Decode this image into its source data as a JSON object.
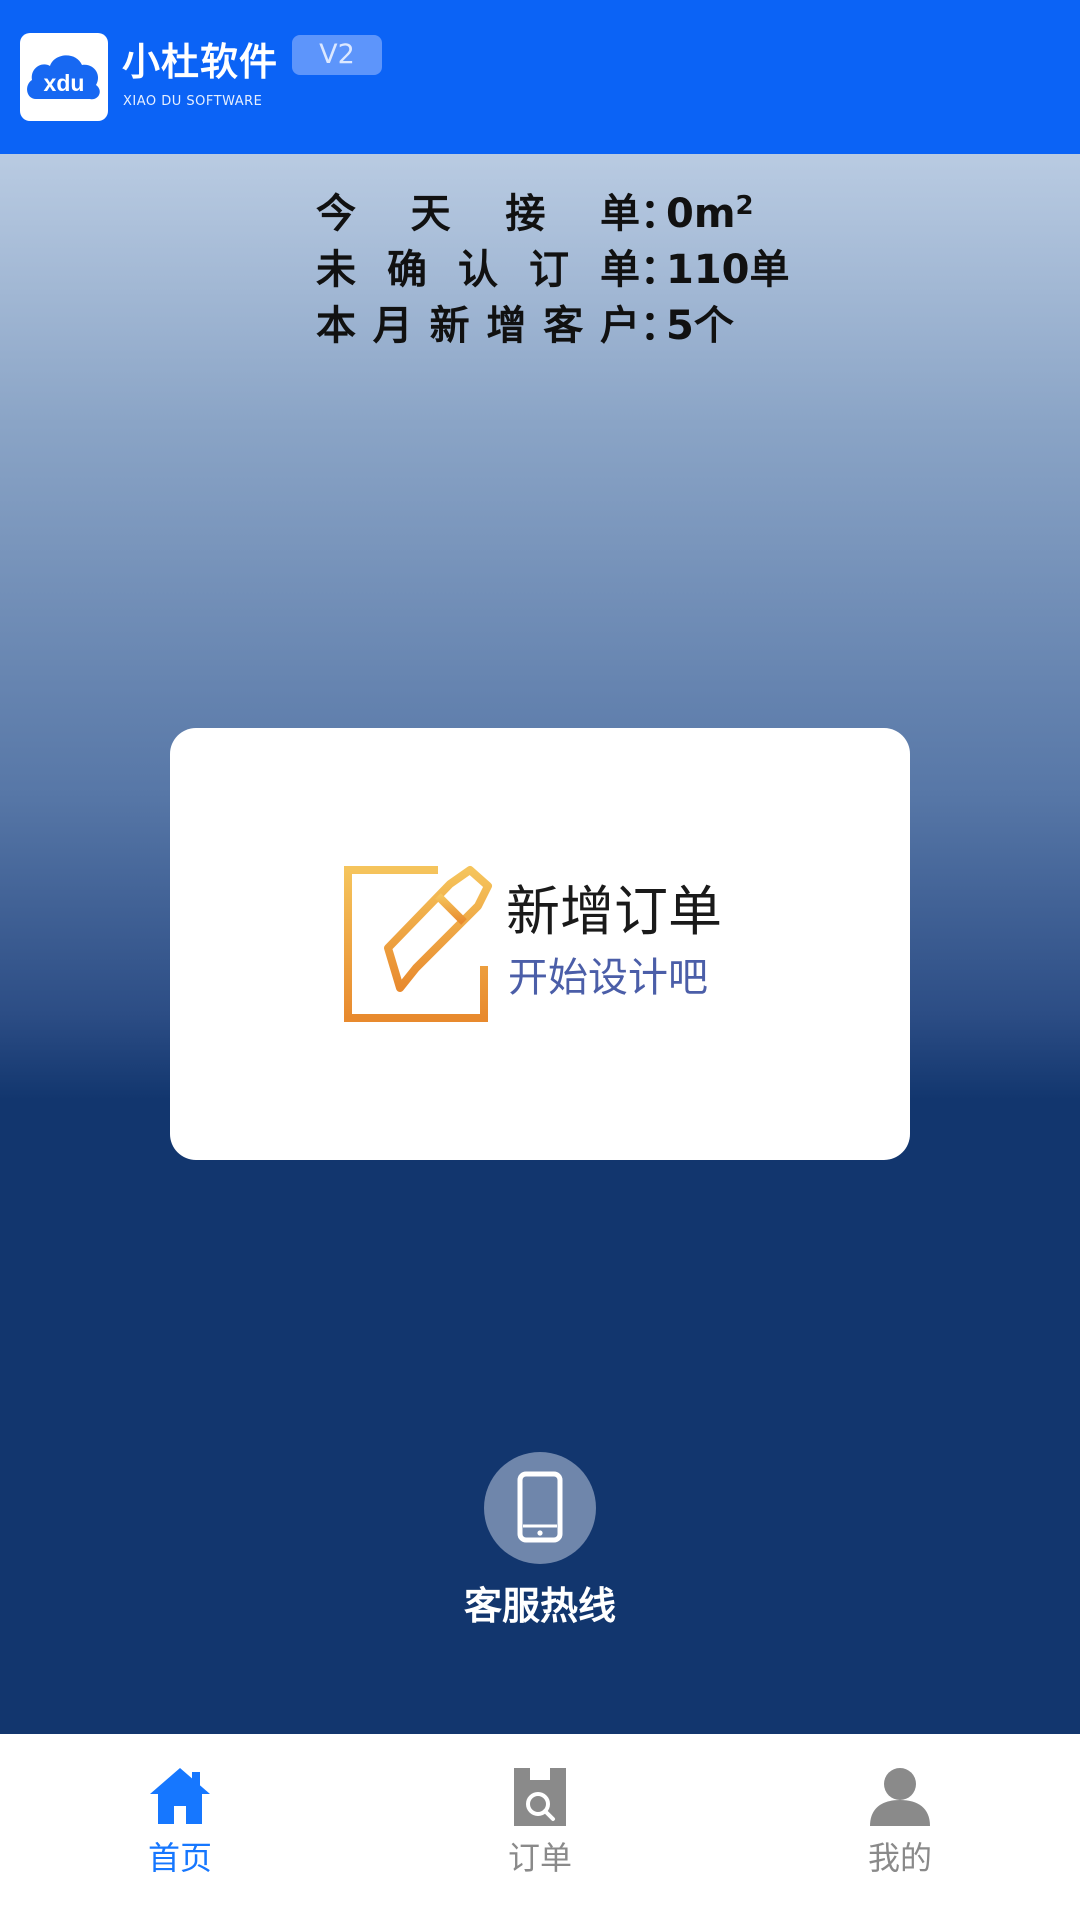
{
  "header": {
    "logo_text": "xdu",
    "brand_name": "小杜软件",
    "brand_sub": "XIAO DU SOFTWARE",
    "version": "V2",
    "background_color": "#0b63f6"
  },
  "stats": [
    {
      "label": "今天接单",
      "value": "0m",
      "value_sup": "2"
    },
    {
      "label": "未确认订单",
      "value": "110单",
      "value_sup": ""
    },
    {
      "label": "本月新增客户",
      "value": "5个",
      "value_sup": ""
    }
  ],
  "stat_separator": "：",
  "card": {
    "title": "新增订单",
    "subtitle": "开始设计吧",
    "icon": "edit-icon",
    "icon_color": "#f0a63a",
    "subtitle_color": "#4b5ea8"
  },
  "hotline": {
    "label": "客服热线",
    "icon": "phone-icon"
  },
  "tabs": [
    {
      "label": "首页",
      "icon": "home-icon",
      "active": true
    },
    {
      "label": "订单",
      "icon": "order-search-icon",
      "active": false
    },
    {
      "label": "我的",
      "icon": "user-icon",
      "active": false
    }
  ],
  "colors": {
    "accent": "#1677ff",
    "tab_inactive": "#8a8a8a",
    "hero_dark": "#12366e"
  }
}
